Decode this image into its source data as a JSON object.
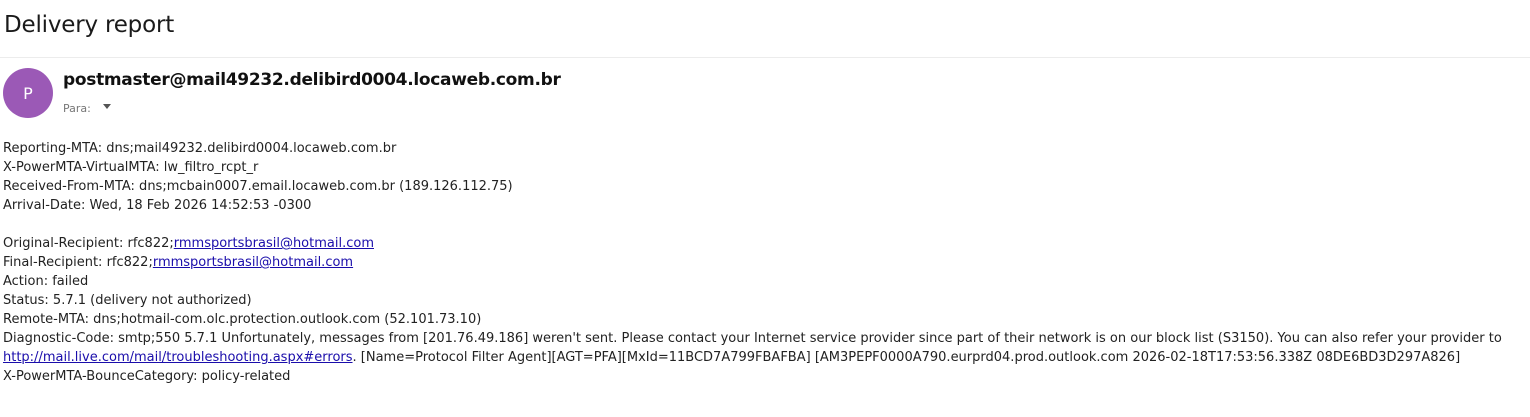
{
  "subject": "Delivery report",
  "sender": {
    "avatar_initial": "P",
    "avatar_color": "#9b59b6",
    "address": "postmaster@mail49232.delibird0004.locaweb.com.br",
    "to_label": "Para:"
  },
  "report": {
    "reporting_mta": "Reporting-MTA: dns;mail49232.delibird0004.locaweb.com.br",
    "virtual_mta": "X-PowerMTA-VirtualMTA: lw_filtro_rcpt_r",
    "received_from": "Received-From-MTA: dns;mcbain0007.email.locaweb.com.br (189.126.112.75)",
    "arrival_date": "Arrival-Date: Wed, 18 Feb 2026 14:52:53 -0300",
    "original_recipient_prefix": "Original-Recipient: rfc822;",
    "original_recipient_link": "rmmsportsbrasil@hotmail.com",
    "final_recipient_prefix": "Final-Recipient: rfc822;",
    "final_recipient_link": "rmmsportsbrasil@hotmail.com",
    "action": "Action: failed",
    "status": "Status: 5.7.1 (delivery not authorized)",
    "remote_mta": "Remote-MTA: dns;hotmail-com.olc.protection.outlook.com (52.101.73.10)",
    "diagnostic_line1": "Diagnostic-Code: smtp;550 5.7.1 Unfortunately, messages from [201.76.49.186] weren't sent. Please contact your Internet service provider since part of their network is on our block list (S3150). You can also refer your provider to",
    "diagnostic_link": "http://mail.live.com/mail/troubleshooting.aspx#errors",
    "diagnostic_line2_rest": ". [Name=Protocol Filter Agent][AGT=PFA][MxId=11BCD7A799FBAFBA] [AM3PEPF0000A790.eurprd04.prod.outlook.com 2026-02-18T17:53:56.338Z 08DE6BD3D297A826]",
    "bounce_category": "X-PowerMTA-BounceCategory: policy-related"
  }
}
